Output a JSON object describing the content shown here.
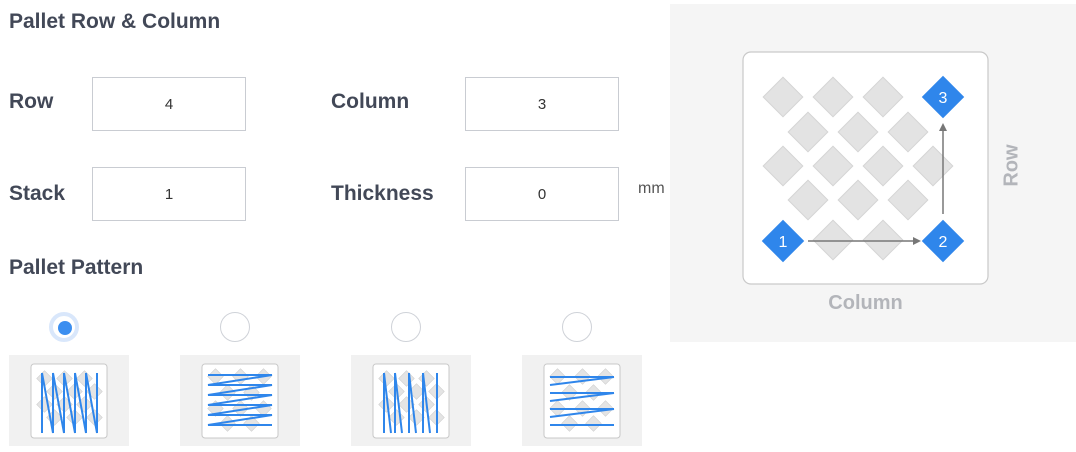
{
  "section_titles": {
    "row_column": "Pallet Row & Column",
    "pattern": "Pallet Pattern"
  },
  "fields": {
    "row": {
      "label": "Row",
      "value": "4"
    },
    "column": {
      "label": "Column",
      "value": "3"
    },
    "stack": {
      "label": "Stack",
      "value": "1"
    },
    "thickness": {
      "label": "Thickness",
      "value": "0",
      "unit": "mm"
    }
  },
  "patterns": {
    "selected_index": 0,
    "options": [
      {
        "name": "column-zigzag"
      },
      {
        "name": "row-zigzag"
      },
      {
        "name": "column-return"
      },
      {
        "name": "row-return"
      }
    ]
  },
  "preview": {
    "row_axis_label": "Row",
    "column_axis_label": "Column",
    "markers": [
      "1",
      "2",
      "3"
    ],
    "accent_color": "#2f86eb"
  }
}
